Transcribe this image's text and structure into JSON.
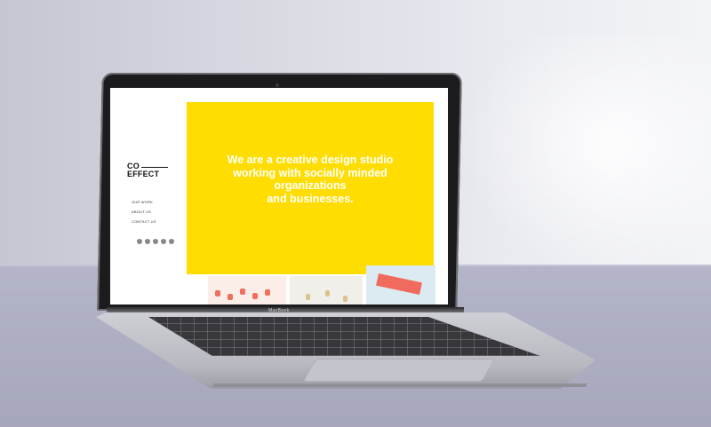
{
  "brand": {
    "logo_line1": "CO",
    "logo_line2": "EFFECT"
  },
  "nav": {
    "items": [
      "OUR WORK",
      "ABOUT US",
      "CONTACT US"
    ]
  },
  "hero": {
    "lines": [
      "We are a creative design studio",
      "working with socially minded",
      "organizations",
      "and businesses."
    ],
    "background_color": "#ffdd00",
    "text_color": "#ffffff"
  },
  "social_icons": [
    "facebook-icon",
    "twitter-icon",
    "instagram-icon",
    "pinterest-icon",
    "linkedin-icon"
  ],
  "laptop": {
    "label": "MacBook"
  }
}
